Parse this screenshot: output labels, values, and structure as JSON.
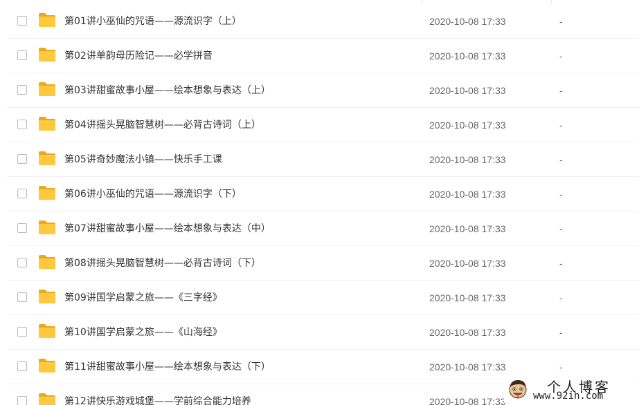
{
  "files": [
    {
      "name": "第01讲小巫仙的咒语——源流识字（上）",
      "modified": "2020-10-08 17:33",
      "size": "-"
    },
    {
      "name": "第02讲单韵母历险记——必学拼音",
      "modified": "2020-10-08 17:33",
      "size": "-"
    },
    {
      "name": "第03讲甜蜜故事小屋——绘本想象与表达（上）",
      "modified": "2020-10-08 17:33",
      "size": "-"
    },
    {
      "name": "第04讲摇头晃脑智慧树——必背古诗词（上）",
      "modified": "2020-10-08 17:33",
      "size": "-"
    },
    {
      "name": "第05讲奇妙魔法小镇——快乐手工课",
      "modified": "2020-10-08 17:33",
      "size": "-"
    },
    {
      "name": "第06讲小巫仙的咒语——源流识字（下）",
      "modified": "2020-10-08 17:33",
      "size": "-"
    },
    {
      "name": "第07讲甜蜜故事小屋——绘本想象与表达（中）",
      "modified": "2020-10-08 17:33",
      "size": "-"
    },
    {
      "name": "第08讲摇头晃脑智慧树——必背古诗词（下）",
      "modified": "2020-10-08 17:33",
      "size": "-"
    },
    {
      "name": "第09讲国学启蒙之旅——《三字经》",
      "modified": "2020-10-08 17:33",
      "size": "-"
    },
    {
      "name": "第10讲国学启蒙之旅——《山海经》",
      "modified": "2020-10-08 17:33",
      "size": "-"
    },
    {
      "name": "第11讲甜蜜故事小屋——绘本想象与表达（下）",
      "modified": "2020-10-08 17:33",
      "size": "-"
    },
    {
      "name": "第12讲快乐游戏城堡——学前综合能力培养",
      "modified": "2020-10-08 17:33",
      "size": "-"
    }
  ],
  "watermark": {
    "title": "个人博客",
    "url": "www.92in.com"
  },
  "colors": {
    "folder": "#ffc83d",
    "text": "#333333",
    "muted": "#666666"
  },
  "icons": {
    "row_checkbox": "checkbox-icon",
    "row_folder": "folder-icon",
    "watermark_logo": "cartoon-face-icon"
  }
}
